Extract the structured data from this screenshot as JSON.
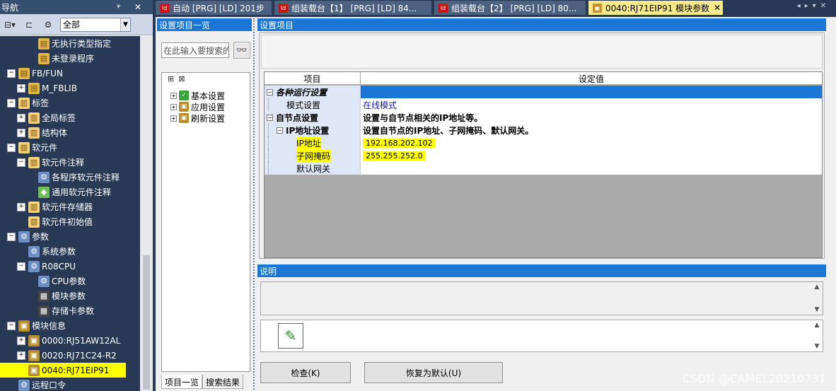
{
  "nav": {
    "title": "导航",
    "pin": "ᵠ ✕",
    "filter": "全部",
    "tree": [
      {
        "indent": 2,
        "exp": "",
        "icon": "folder",
        "label": "无执行类型指定"
      },
      {
        "indent": 2,
        "exp": "",
        "icon": "folder",
        "label": "未登录程序"
      },
      {
        "indent": 0,
        "exp": "−",
        "icon": "folder",
        "label": "FB/FUN"
      },
      {
        "indent": 1,
        "exp": "+",
        "icon": "folder",
        "label": "M_FBLIB"
      },
      {
        "indent": 0,
        "exp": "−",
        "icon": "doc",
        "label": "标签"
      },
      {
        "indent": 1,
        "exp": "+",
        "icon": "doc",
        "label": "全局标签"
      },
      {
        "indent": 1,
        "exp": "+",
        "icon": "doc",
        "label": "结构体"
      },
      {
        "indent": 0,
        "exp": "−",
        "icon": "doc",
        "label": "软元件"
      },
      {
        "indent": 1,
        "exp": "−",
        "icon": "doc",
        "label": "软元件注释"
      },
      {
        "indent": 2,
        "exp": "",
        "icon": "param",
        "label": "各程序软元件注释"
      },
      {
        "indent": 2,
        "exp": "",
        "icon": "green",
        "label": "通用软元件注释"
      },
      {
        "indent": 1,
        "exp": "+",
        "icon": "doc",
        "label": "软元件存储器"
      },
      {
        "indent": 1,
        "exp": "",
        "icon": "doc",
        "label": "软元件初始值"
      },
      {
        "indent": 0,
        "exp": "−",
        "icon": "param",
        "label": "参数"
      },
      {
        "indent": 1,
        "exp": "",
        "icon": "param",
        "label": "系统参数"
      },
      {
        "indent": 1,
        "exp": "−",
        "icon": "param",
        "label": "R08CPU"
      },
      {
        "indent": 2,
        "exp": "",
        "icon": "param",
        "label": "CPU参数"
      },
      {
        "indent": 2,
        "exp": "",
        "icon": "cpu",
        "label": "模块参数"
      },
      {
        "indent": 2,
        "exp": "",
        "icon": "cpu",
        "label": "存储卡参数"
      },
      {
        "indent": 0,
        "exp": "−",
        "icon": "mod",
        "label": "模块信息"
      },
      {
        "indent": 1,
        "exp": "+",
        "icon": "mod",
        "label": "0000:RJ51AW12AL"
      },
      {
        "indent": 1,
        "exp": "+",
        "icon": "mod",
        "label": "0020:RJ71C24-R2"
      },
      {
        "indent": 1,
        "exp": "",
        "icon": "mod",
        "label": "0040:RJ71EIP91",
        "highlight": true
      },
      {
        "indent": 0,
        "exp": "",
        "icon": "param",
        "label": "远程口令"
      }
    ]
  },
  "tabs": [
    {
      "label": "自动 [PRG] [LD] 201步",
      "active": false
    },
    {
      "label": "组装载台【1】 [PRG] [LD] 84...",
      "active": false
    },
    {
      "label": "组装载台【2】 [PRG] [LD] 80...",
      "active": false
    },
    {
      "label": "0040:RJ71EIP91 模块参数",
      "active": true
    }
  ],
  "left_pane": {
    "title": "设置项目一览",
    "search_placeholder": "在此输入要搜索的",
    "items": [
      "基本设置",
      "应用设置",
      "刷新设置"
    ],
    "bottom_tabs": [
      "项目一览",
      "搜索结果"
    ]
  },
  "settings": {
    "title": "设置项目",
    "col_item": "项目",
    "col_value": "设定值",
    "rows": [
      {
        "item": "各种运行设置",
        "value": "",
        "level": 0,
        "exp": "−",
        "italic": true,
        "selected": true
      },
      {
        "item": "模式设置",
        "value": "在线模式",
        "level": 1,
        "exp": "",
        "valueColor": "blue"
      },
      {
        "item": "自节点设置",
        "value": "设置与自节点相关的IP地址等。",
        "level": 0,
        "exp": "−",
        "bold": true
      },
      {
        "item": "IP地址设置",
        "value": "设置自节点的IP地址、子网掩码、默认网关。",
        "level": 1,
        "exp": "−",
        "bold": true
      },
      {
        "item": "IP地址",
        "value": "192.168.202.102",
        "level": 2,
        "exp": "",
        "highlight": true
      },
      {
        "item": "子网掩码",
        "value": "255.255.252.0",
        "level": 2,
        "exp": "",
        "highlight": true
      },
      {
        "item": "默认网关",
        "value": "",
        "level": 2,
        "exp": ""
      }
    ]
  },
  "explain": {
    "title": "说明"
  },
  "buttons": {
    "check": "检查(K)",
    "reset": "恢复为默认(U)"
  },
  "watermark": "CSDN @CAMEL20210731"
}
